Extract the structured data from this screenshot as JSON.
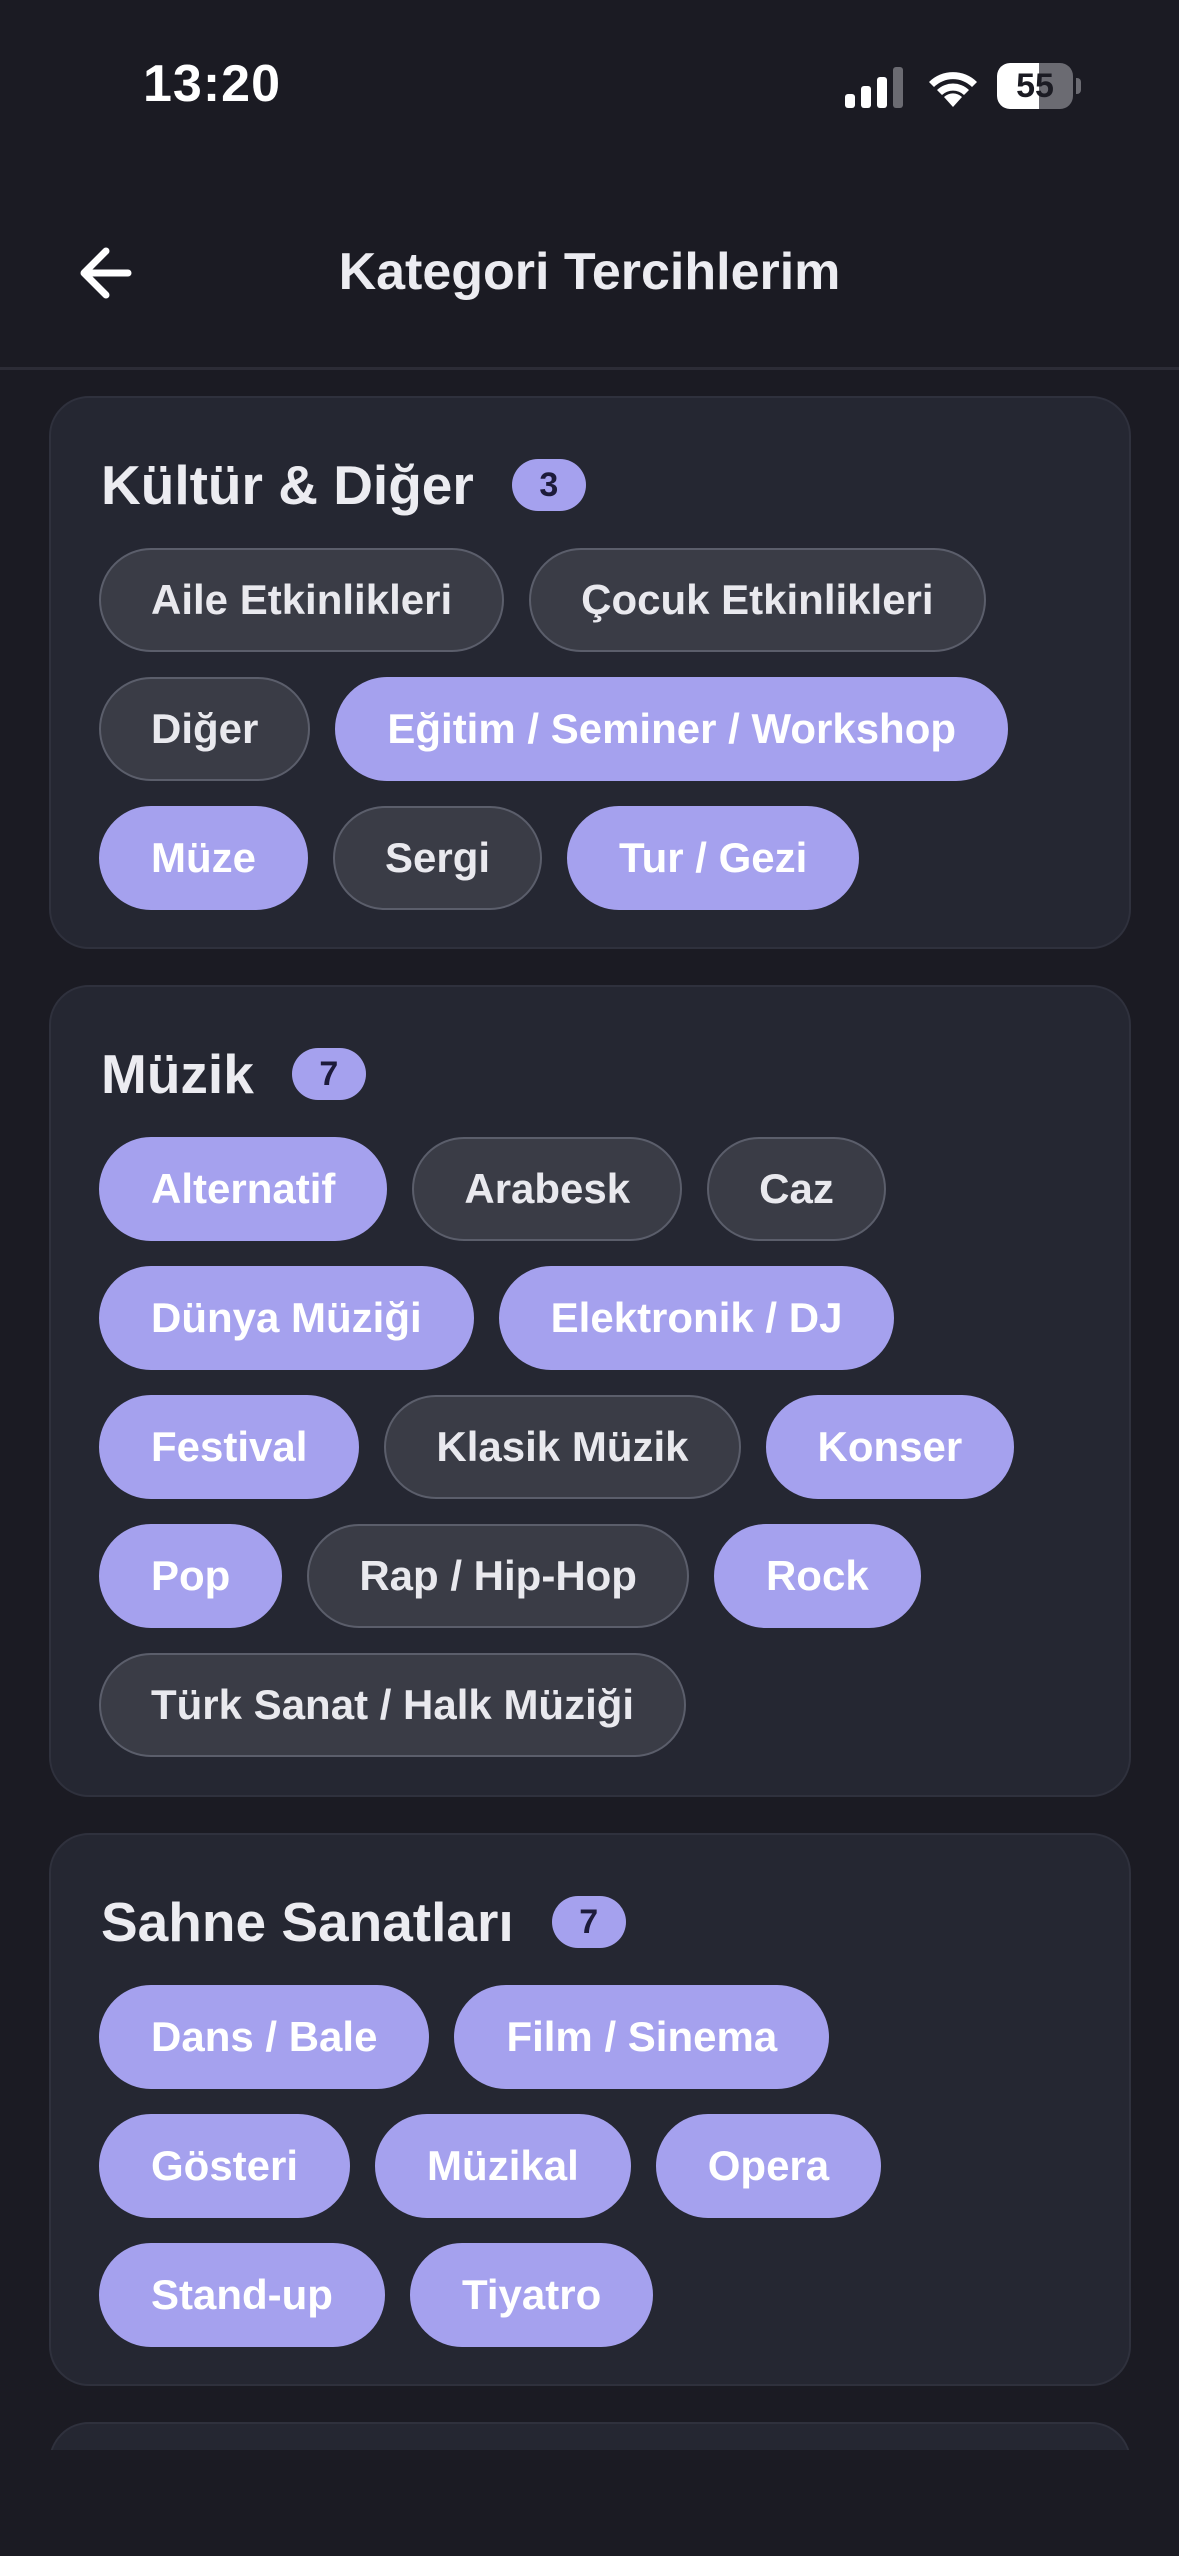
{
  "status_bar": {
    "time": "13:20",
    "battery_level": "55",
    "icons": [
      "signal-icon",
      "wifi-icon",
      "battery-icon"
    ]
  },
  "header": {
    "title": "Kategori Tercihlerim",
    "back_icon": "arrow-left-icon"
  },
  "colors": {
    "background": "#1b1b23",
    "card": "#252732",
    "accent": "#a5a1ee",
    "chip_unselected": "#3a3c46"
  },
  "groups": [
    {
      "title": "Kültür & Diğer",
      "count": "3",
      "chips": [
        {
          "label": "Aile Etkinlikleri",
          "selected": false
        },
        {
          "label": "Çocuk Etkinlikleri",
          "selected": false
        },
        {
          "label": "Diğer",
          "selected": false
        },
        {
          "label": "Eğitim / Seminer / Workshop",
          "selected": true
        },
        {
          "label": "Müze",
          "selected": true
        },
        {
          "label": "Sergi",
          "selected": false
        },
        {
          "label": "Tur / Gezi",
          "selected": true
        }
      ]
    },
    {
      "title": "Müzik",
      "count": "7",
      "chips": [
        {
          "label": "Alternatif",
          "selected": true
        },
        {
          "label": "Arabesk",
          "selected": false
        },
        {
          "label": "Caz",
          "selected": false
        },
        {
          "label": "Dünya Müziği",
          "selected": true
        },
        {
          "label": "Elektronik / DJ",
          "selected": true
        },
        {
          "label": "Festival",
          "selected": true
        },
        {
          "label": "Klasik Müzik",
          "selected": false
        },
        {
          "label": "Konser",
          "selected": true
        },
        {
          "label": "Pop",
          "selected": true
        },
        {
          "label": "Rap / Hip-Hop",
          "selected": false
        },
        {
          "label": "Rock",
          "selected": true
        },
        {
          "label": "Türk Sanat / Halk Müziği",
          "selected": false
        }
      ]
    },
    {
      "title": "Sahne Sanatları",
      "count": "7",
      "chips": [
        {
          "label": "Dans / Bale",
          "selected": true
        },
        {
          "label": "Film / Sinema",
          "selected": true
        },
        {
          "label": "Gösteri",
          "selected": true
        },
        {
          "label": "Müzikal",
          "selected": true
        },
        {
          "label": "Opera",
          "selected": true
        },
        {
          "label": "Stand-up",
          "selected": true
        },
        {
          "label": "Tiyatro",
          "selected": true
        }
      ]
    }
  ]
}
